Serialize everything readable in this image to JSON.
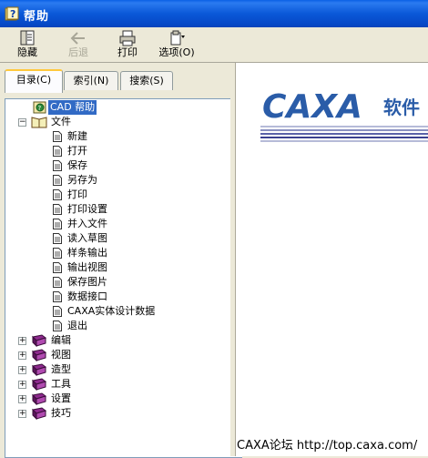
{
  "window": {
    "title": "帮助"
  },
  "toolbar": {
    "hide_label": "隐藏",
    "back_label": "后退",
    "print_label": "打印",
    "options_label": "选项(O)"
  },
  "tabs": [
    {
      "label": "目录(C)"
    },
    {
      "label": "索引(N)"
    },
    {
      "label": "搜索(S)"
    }
  ],
  "tree": {
    "root": "CAD 帮助",
    "file_folder": "文件",
    "file_items": [
      "新建",
      "打开",
      "保存",
      "另存为",
      "打印",
      "打印设置",
      "并入文件",
      "读入草图",
      "样条输出",
      "输出视图",
      "保存图片",
      "数据接口",
      "CAXA实体设计数据",
      "退出"
    ],
    "folders": [
      "编辑",
      "视图",
      "造型",
      "工具",
      "设置",
      "技巧"
    ]
  },
  "content": {
    "logo_text": "CAXA",
    "logo_suffix": "软件"
  },
  "footer": {
    "text": "CAXA论坛 http://top.caxa.com/"
  },
  "colors": {
    "title_blue": "#0A58D8",
    "logo_blue": "#2A5CA8",
    "selection": "#316AC5"
  }
}
